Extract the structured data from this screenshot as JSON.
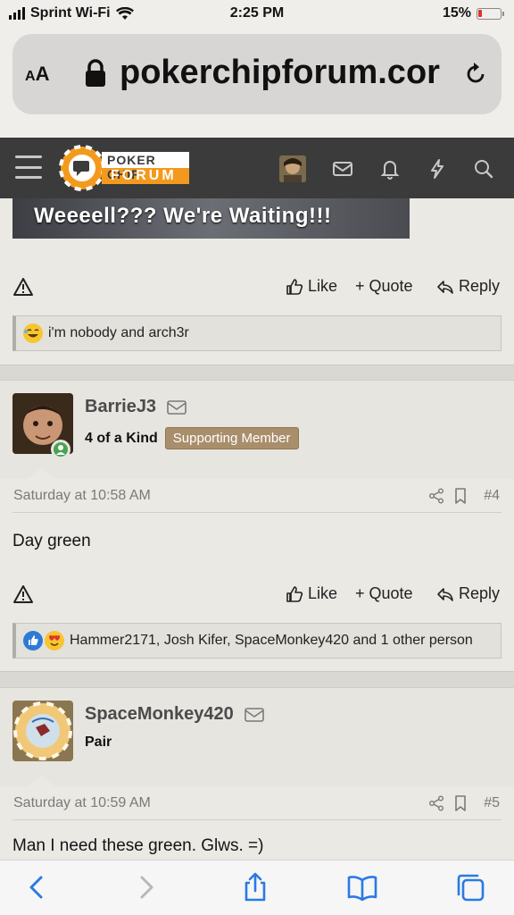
{
  "status_bar": {
    "carrier": "Sprint Wi-Fi",
    "time": "2:25 PM",
    "battery": "15%"
  },
  "browser": {
    "text_size_label_big": "A",
    "text_size_label_small": "A",
    "url": "pokerchipforum.cor",
    "lock_icon": "lock-icon",
    "reload_icon": "reload-icon"
  },
  "site_header": {
    "logo_top": "POKER CHIP",
    "logo_bottom": "FORUM",
    "icons": [
      "menu-icon",
      "avatar",
      "mail-icon",
      "bell-icon",
      "bolt-icon",
      "search-icon"
    ]
  },
  "colors": {
    "header_bg": "#3a3b3a",
    "logo_orange": "#f39a1e",
    "badge_bg": "#a98e6b",
    "online_green": "#4aa24f"
  },
  "posts": [
    {
      "embedded_image_caption": "Weeeell??? We're Waiting!!!",
      "actions": {
        "like": "Like",
        "quote": "+ Quote",
        "reply": "Reply"
      },
      "reactions_text": "i'm nobody and arch3r"
    },
    {
      "username": "BarrieJ3",
      "user_title": "4 of a Kind",
      "badge": "Supporting Member",
      "timestamp": "Saturday at 10:58 AM",
      "post_number": "#4",
      "body": "Day green",
      "actions": {
        "like": "Like",
        "quote": "+ Quote",
        "reply": "Reply"
      },
      "reactions_text": "Hammer2171, Josh Kifer, SpaceMonkey420 and 1 other person"
    },
    {
      "username": "SpaceMonkey420",
      "user_title": "Pair",
      "timestamp": "Saturday at 10:59 AM",
      "post_number": "#5",
      "body": "Man I need these green. Glws. =)"
    }
  ],
  "bottom_toolbar": [
    "back-icon",
    "forward-icon",
    "share-icon",
    "bookmarks-icon",
    "tabs-icon"
  ]
}
